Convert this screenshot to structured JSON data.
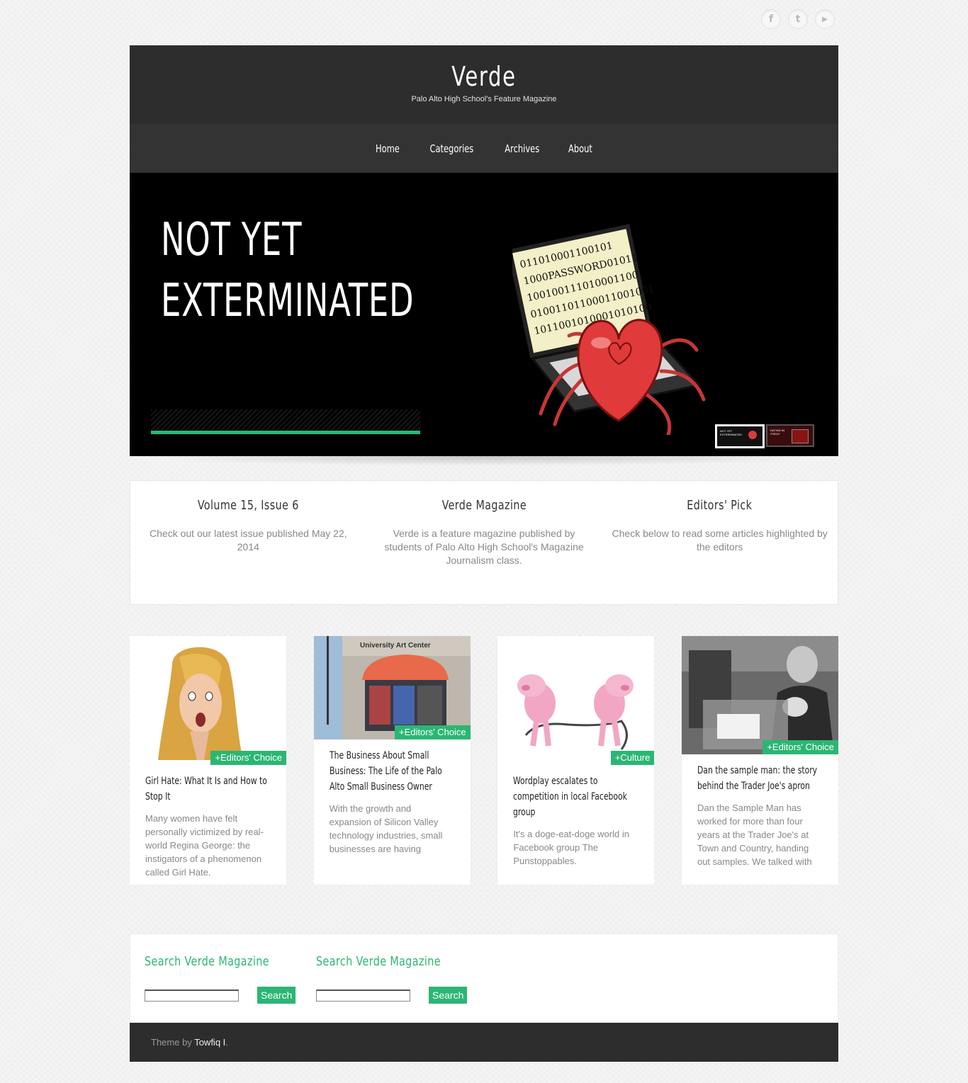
{
  "social": {
    "facebook": "f",
    "twitter": "t",
    "youtube": "▶"
  },
  "site": {
    "title": "Verde",
    "tagline": "Palo Alto High School's Feature Magazine"
  },
  "nav": [
    "Home",
    "Categories",
    "Archives",
    "About"
  ],
  "slider": {
    "title_line1": "NOT YET",
    "title_line2": "EXTERMINATED",
    "art_code_rows": [
      "011010001100101",
      "1000PASSWORD01011",
      "100100111010001100",
      "01001101100011001001",
      "1011001010001010100"
    ],
    "thumb_active_label": "NOT YET EXTERMINATED",
    "thumb_other_label": "DATING IN ITSELF"
  },
  "intro": [
    {
      "title": "Volume 15, Issue 6",
      "text": "Check out our latest issue published May 22, 2014"
    },
    {
      "title": "Verde Magazine",
      "text": "Verde is a feature magazine published by students of Palo Alto High School's Magazine Journalism class."
    },
    {
      "title": "Editors' Pick",
      "text": "Check below to read some articles highlighted by the editors"
    }
  ],
  "cards": [
    {
      "tag": "+Editors' Choice",
      "title": "Girl Hate: What It Is and How to Stop It",
      "excerpt": "Many women have felt personally victimized by real-world Regina George: the instigators of a phenomenon called Girl Hate."
    },
    {
      "tag": "+Editors' Choice",
      "title": "The Business About Small Business: The Life of the Palo Alto Small Business Owner",
      "excerpt": "With the growth and expansion of Silicon Valley technology industries, small businesses are having",
      "sign": "University Art Center"
    },
    {
      "tag": "+Culture",
      "title": "Wordplay escalates to competition in local Facebook group",
      "excerpt": "It's a doge-eat-doge world in Facebook group The Punstoppables."
    },
    {
      "tag": "+Editors' Choice",
      "title": "Dan the sample man: the story behind the Trader Joe's apron",
      "excerpt": "Dan the Sample Man has worked for more than four years at the Trader Joe's at Town and Country, handing out samples. We talked with"
    }
  ],
  "widgets": [
    {
      "title": "Search Verde Magazine",
      "button": "Search"
    },
    {
      "title": "Search Verde Magazine",
      "button": "Search"
    }
  ],
  "footer": {
    "prefix": "Theme by",
    "author": "Towfiq I",
    "suffix": "."
  },
  "colors": {
    "accent": "#2bb673",
    "header": "#2d2d2d",
    "nav": "#333333"
  }
}
